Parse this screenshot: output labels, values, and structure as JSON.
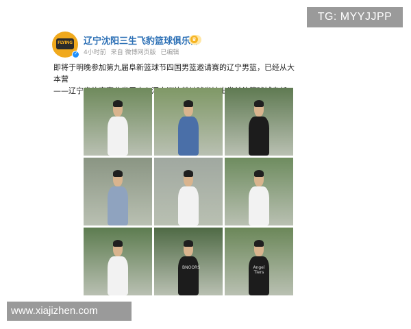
{
  "watermark": {
    "tg_label": "TG: MYYJJPP",
    "site_label": "www.xiajizhen.com"
  },
  "post": {
    "account_name": "辽宁沈阳三生飞豹篮球俱乐部",
    "badge_label": "",
    "time": "4小时前",
    "source": "来自 微博网页版",
    "edited": "已编辑",
    "text_line1": "即将于明晚参加第九届阜新篮球节四国男篮邀请赛的辽宁男篮，已经从大本营",
    "text_line2": "——辽宁省体育事业发展中心浑南训练基地球类馆出发前往篮球城阜新。",
    "avatar_text": "FLYING",
    "photos": [
      {
        "shirt": "white",
        "shirt_print": ""
      },
      {
        "shirt": "blue",
        "shirt_print": ""
      },
      {
        "shirt": "black",
        "shirt_print": ""
      },
      {
        "shirt": "grey-blue",
        "shirt_print": ""
      },
      {
        "shirt": "white",
        "shirt_print": ""
      },
      {
        "shirt": "white",
        "shirt_print": ""
      },
      {
        "shirt": "white",
        "shirt_print": ""
      },
      {
        "shirt": "black",
        "shirt_print": "BNOORS"
      },
      {
        "shirt": "black",
        "shirt_print": "Angel Tiers"
      }
    ]
  },
  "colors": {
    "name_blue": "#2b6fb5",
    "meta_grey": "#999999",
    "watermark_grey": "#9a9a9a"
  }
}
